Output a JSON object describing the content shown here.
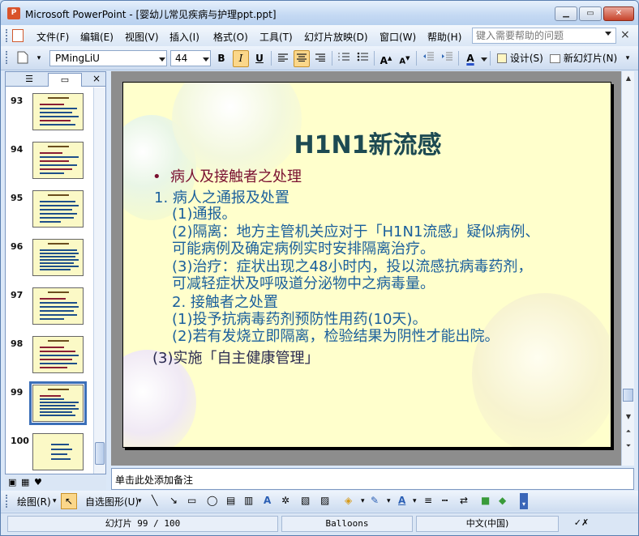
{
  "window": {
    "title": "Microsoft PowerPoint - [婴幼儿常见疾病与护理ppt.ppt]",
    "app_icon": "P",
    "controls": [
      "minimize-icon",
      "restore-icon",
      "close-icon"
    ]
  },
  "menu": {
    "items": [
      "文件(F)",
      "编辑(E)",
      "视图(V)",
      "插入(I)",
      "格式(O)",
      "工具(T)",
      "幻灯片放映(D)",
      "窗口(W)",
      "帮助(H)"
    ],
    "help_placeholder": "键入需要帮助的问题",
    "close_glyph": "×"
  },
  "toolbar": {
    "font": "PMingLiU",
    "size": "44",
    "bold": "B",
    "italic": "I",
    "underline": "U",
    "design_label": "设计(S)",
    "new_slide_label": "新幻灯片(N)"
  },
  "slide_panel": {
    "tabs": [
      "outline-tab-icon",
      "slides-tab-icon"
    ],
    "close_glyph": "×",
    "slides": [
      {
        "num": "93"
      },
      {
        "num": "94"
      },
      {
        "num": "95"
      },
      {
        "num": "96"
      },
      {
        "num": "97"
      },
      {
        "num": "98"
      },
      {
        "num": "99",
        "selected": true
      },
      {
        "num": "100"
      }
    ]
  },
  "slide": {
    "title": "H1N1新流感",
    "bullet": "•",
    "lines": [
      {
        "text": "病人及接触者之处理",
        "style": "red",
        "indent": 1
      },
      {
        "text": "1. 病人之通报及处置",
        "style": "blue",
        "indent": 0
      },
      {
        "text": "(1)通报。",
        "style": "blue",
        "indent": 2
      },
      {
        "text": "(2)隔离：地方主管机关应对于「H1N1流感」疑似病例、",
        "style": "blue",
        "indent": 2
      },
      {
        "text": "可能病例及确定病例实时安排隔离治疗。",
        "style": "blue",
        "indent": 2
      },
      {
        "text": "(3)治疗：症状出现之48小时内，投以流感抗病毒药剂，",
        "style": "blue",
        "indent": 2
      },
      {
        "text": "可减轻症状及呼吸道分泌物中之病毒量。",
        "style": "blue",
        "indent": 2
      },
      {
        "text": "2. 接触者之处置",
        "style": "blue",
        "indent": 2
      },
      {
        "text": "(1)投予抗病毒药剂预防性用药(10天)。",
        "style": "blue",
        "indent": 2
      },
      {
        "text": "(2)若有发烧立即隔离，检验结果为阴性才能出院。",
        "style": "blue",
        "indent": 2
      },
      {
        "text": "(3)实施「自主健康管理」",
        "style": "dark",
        "indent": 0
      }
    ]
  },
  "notes": {
    "placeholder": "单击此处添加备注"
  },
  "drawing_toolbar": {
    "draw_label": "绘图(R)",
    "autoshapes_label": "自选图形(U)"
  },
  "status": {
    "slide_position": "幻灯片 99 / 100",
    "theme": "Balloons",
    "language": "中文(中国)"
  }
}
